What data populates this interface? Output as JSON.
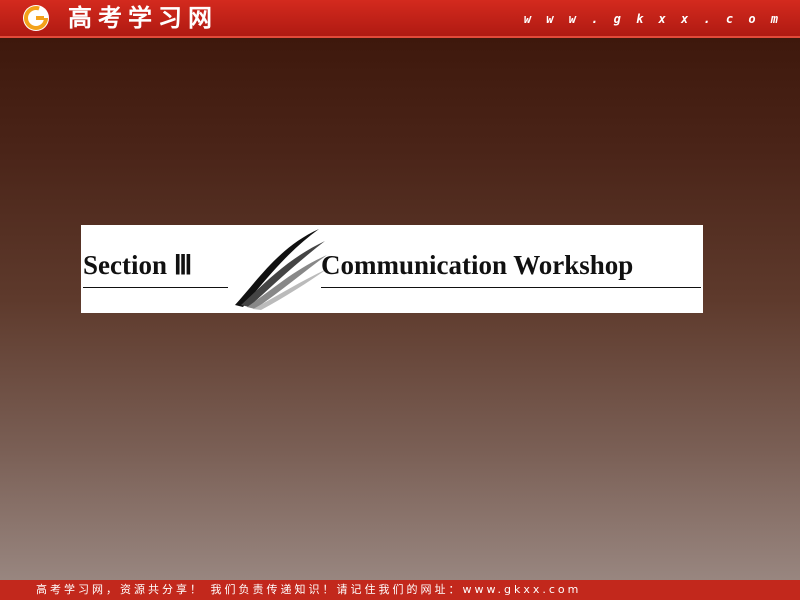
{
  "header": {
    "logo_icon": "g-circle-logo-icon",
    "site_name": "高考学习网",
    "site_url": "w w w . g k x x . c o m",
    "colors": {
      "bar": "#c42218",
      "logo_orange": "#f3a21a"
    }
  },
  "slide": {
    "section_label": "Section Ⅲ",
    "title": "Communication Workshop",
    "decoration_icon": "swoosh-icon"
  },
  "footer": {
    "text": "高考学习网，资源共分享！ 我们负责传递知识！请记住我们的网址：www.gkxx.com"
  }
}
